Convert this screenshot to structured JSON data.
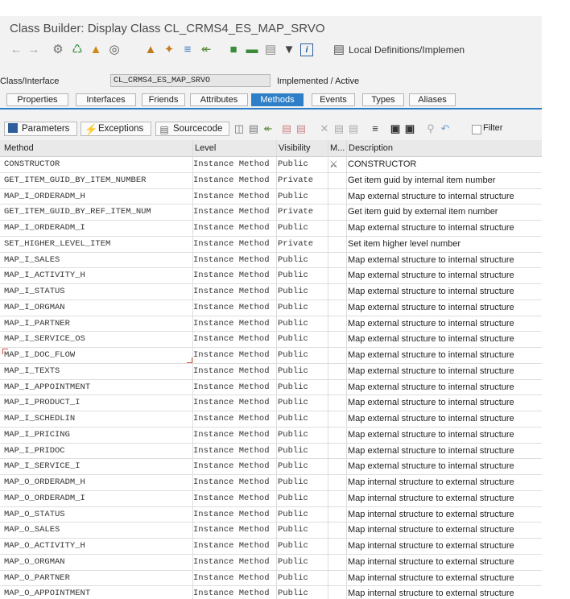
{
  "window": {
    "title": "Class Builder: Display Class CL_CRMS4_ES_MAP_SRVO"
  },
  "toolbar": {
    "local_definitions_label": "Local Definitions/Implemen"
  },
  "class_row": {
    "label": "Class/Interface",
    "value": "CL_CRMS4_ES_MAP_SRVO",
    "status": "Implemented / Active"
  },
  "tabs": [
    {
      "label": "Properties"
    },
    {
      "label": "Interfaces"
    },
    {
      "label": "Friends"
    },
    {
      "label": "Attributes"
    },
    {
      "label": "Methods"
    },
    {
      "label": "Events"
    },
    {
      "label": "Types"
    },
    {
      "label": "Aliases"
    }
  ],
  "grid_toolbar": {
    "parameters_label": "Parameters",
    "exceptions_label": "Exceptions",
    "sourcecode_label": "Sourcecode",
    "filter_label": "Filter"
  },
  "columns": {
    "method": "Method",
    "level": "Level",
    "visibility": "Visibility",
    "modeled": "M...",
    "description": "Description"
  },
  "rows": [
    {
      "method": "CONSTRUCTOR",
      "level": "Instance Method",
      "visibility": "Public",
      "description": "CONSTRUCTOR",
      "modeled_icon": "constructor-icon"
    },
    {
      "method": "GET_ITEM_GUID_BY_ITEM_NUMBER",
      "level": "Instance Method",
      "visibility": "Private",
      "description": "Get item guid by internal item number"
    },
    {
      "method": "MAP_I_ORDERADM_H",
      "level": "Instance Method",
      "visibility": "Public",
      "description": "Map external structure to internal structure"
    },
    {
      "method": "GET_ITEM_GUID_BY_REF_ITEM_NUM",
      "level": "Instance Method",
      "visibility": "Private",
      "description": "Get item guid by external item number"
    },
    {
      "method": "MAP_I_ORDERADM_I",
      "level": "Instance Method",
      "visibility": "Public",
      "description": "Map external structure to internal structure"
    },
    {
      "method": "SET_HIGHER_LEVEL_ITEM",
      "level": "Instance Method",
      "visibility": "Private",
      "description": "Set item higher level number"
    },
    {
      "method": "MAP_I_SALES",
      "level": "Instance Method",
      "visibility": "Public",
      "description": "Map external structure to internal structure"
    },
    {
      "method": "MAP_I_ACTIVITY_H",
      "level": "Instance Method",
      "visibility": "Public",
      "description": "Map external structure to internal structure"
    },
    {
      "method": "MAP_I_STATUS",
      "level": "Instance Method",
      "visibility": "Public",
      "description": "Map external structure to internal structure"
    },
    {
      "method": "MAP_I_ORGMAN",
      "level": "Instance Method",
      "visibility": "Public",
      "description": "Map external structure to internal structure"
    },
    {
      "method": "MAP_I_PARTNER",
      "level": "Instance Method",
      "visibility": "Public",
      "description": "Map external structure to internal structure"
    },
    {
      "method": "MAP_I_SERVICE_OS",
      "level": "Instance Method",
      "visibility": "Public",
      "description": "Map external structure to internal structure"
    },
    {
      "method": "MAP_I_DOC_FLOW",
      "level": "Instance Method",
      "visibility": "Public",
      "description": "Map external structure to internal structure",
      "selected": true
    },
    {
      "method": "MAP_I_TEXTS",
      "level": "Instance Method",
      "visibility": "Public",
      "description": "Map external structure to internal structure"
    },
    {
      "method": "MAP_I_APPOINTMENT",
      "level": "Instance Method",
      "visibility": "Public",
      "description": "Map external structure to internal structure"
    },
    {
      "method": "MAP_I_PRODUCT_I",
      "level": "Instance Method",
      "visibility": "Public",
      "description": "Map external structure to internal structure"
    },
    {
      "method": "MAP_I_SCHEDLIN",
      "level": "Instance Method",
      "visibility": "Public",
      "description": "Map external structure to internal structure"
    },
    {
      "method": "MAP_I_PRICING",
      "level": "Instance Method",
      "visibility": "Public",
      "description": "Map external structure to internal structure"
    },
    {
      "method": "MAP_I_PRIDOC",
      "level": "Instance Method",
      "visibility": "Public",
      "description": "Map external structure to internal structure"
    },
    {
      "method": "MAP_I_SERVICE_I",
      "level": "Instance Method",
      "visibility": "Public",
      "description": "Map external structure to internal structure"
    },
    {
      "method": "MAP_O_ORDERADM_H",
      "level": "Instance Method",
      "visibility": "Public",
      "description": "Map internal structure to external structure"
    },
    {
      "method": "MAP_O_ORDERADM_I",
      "level": "Instance Method",
      "visibility": "Public",
      "description": "Map internal structure to external structure"
    },
    {
      "method": "MAP_O_STATUS",
      "level": "Instance Method",
      "visibility": "Public",
      "description": "Map internal structure to external structure"
    },
    {
      "method": "MAP_O_SALES",
      "level": "Instance Method",
      "visibility": "Public",
      "description": "Map internal structure to external structure"
    },
    {
      "method": "MAP_O_ACTIVITY_H",
      "level": "Instance Method",
      "visibility": "Public",
      "description": "Map internal structure to external structure"
    },
    {
      "method": "MAP_O_ORGMAN",
      "level": "Instance Method",
      "visibility": "Public",
      "description": "Map internal structure to external structure"
    },
    {
      "method": "MAP_O_PARTNER",
      "level": "Instance Method",
      "visibility": "Public",
      "description": "Map internal structure to external structure"
    },
    {
      "method": "MAP_O_APPOINTMENT",
      "level": "Instance Method",
      "visibility": "Public",
      "description": "Map internal structure to external structure"
    }
  ],
  "colors": {
    "accent": "#2e7fc8",
    "header_bg": "#e9e9e9",
    "window_bg": "#f2f2f2"
  }
}
